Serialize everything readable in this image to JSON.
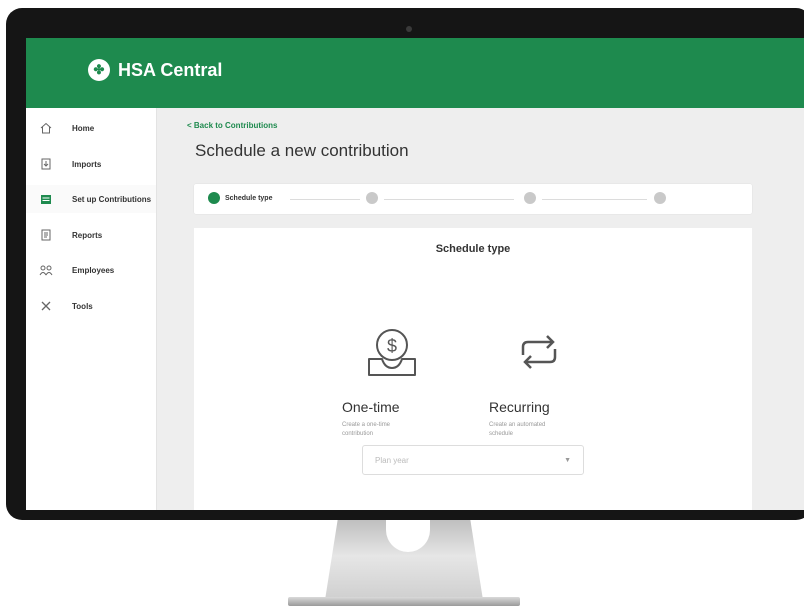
{
  "app": {
    "name": "HSA Central"
  },
  "sidebar": {
    "items": [
      {
        "label": "Home",
        "icon": "home-icon",
        "active": false
      },
      {
        "label": "Imports",
        "icon": "import-icon",
        "active": false
      },
      {
        "label": "Set up Contributions",
        "icon": "calendar-icon",
        "active": true
      },
      {
        "label": "Reports",
        "icon": "report-icon",
        "active": false
      },
      {
        "label": "Employees",
        "icon": "people-icon",
        "active": false
      },
      {
        "label": "Tools",
        "icon": "tools-icon",
        "active": false
      }
    ]
  },
  "header": {
    "back_label": "< Back to Contributions",
    "title": "Schedule a new contribution"
  },
  "stepper": {
    "steps": [
      {
        "label": "Schedule type",
        "active": true
      }
    ]
  },
  "card": {
    "title": "Schedule type",
    "options": [
      {
        "title": "One-time",
        "desc": "Create a one-time contribution",
        "icon": "money-tray-icon"
      },
      {
        "title": "Recurring",
        "desc": "Create an automated schedule",
        "icon": "recurring-arrows-icon"
      }
    ],
    "select": {
      "placeholder": "Plan year"
    }
  },
  "colors": {
    "brand": "#1e8a4e",
    "muted": "#999999"
  }
}
